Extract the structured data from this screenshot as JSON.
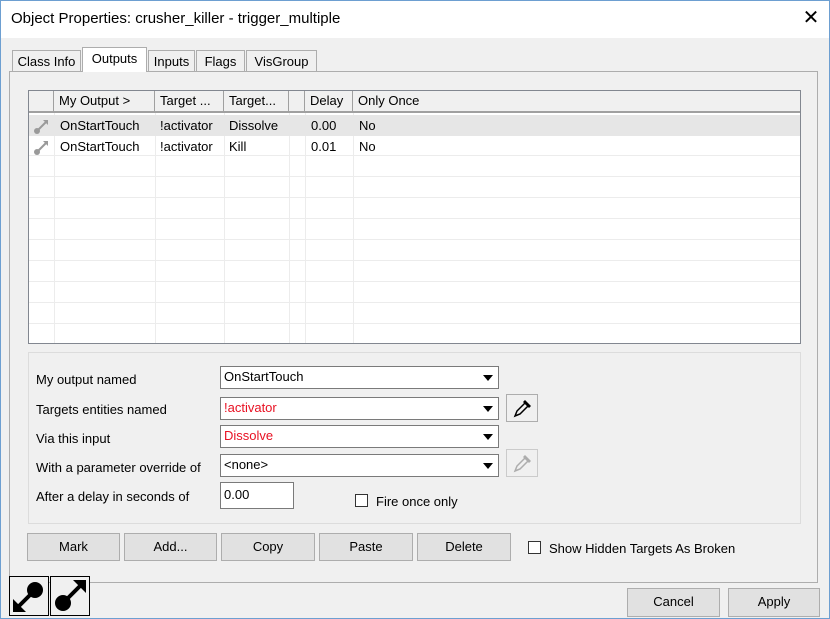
{
  "window": {
    "title": "Object Properties: crusher_killer - trigger_multiple",
    "close_glyph": "✕"
  },
  "tabs": [
    {
      "label": "Class Info",
      "selected": false
    },
    {
      "label": "Outputs",
      "selected": true
    },
    {
      "label": "Inputs",
      "selected": false
    },
    {
      "label": "Flags",
      "selected": false
    },
    {
      "label": "VisGroup",
      "selected": false
    }
  ],
  "outputs_table": {
    "columns": [
      "",
      "My Output  >",
      "Target ...",
      "Target...",
      "",
      "Delay",
      "Only Once"
    ],
    "rows": [
      {
        "icon": "output-connection-icon",
        "output": "OnStartTouch",
        "target": "!activator",
        "input": "Dissolve",
        "param": "",
        "delay": "0.00",
        "once": "No"
      },
      {
        "icon": "output-connection-icon",
        "output": "OnStartTouch",
        "target": "!activator",
        "input": "Kill",
        "param": "",
        "delay": "0.01",
        "once": "No"
      }
    ]
  },
  "editor": {
    "output_label": "My output named",
    "output_value": "OnStartTouch",
    "target_label": "Targets entities named",
    "target_value": "!activator",
    "input_label": "Via this input",
    "input_value": "Dissolve",
    "param_label": "With a parameter override of",
    "param_value": "<none>",
    "delay_label": "After a delay in seconds of",
    "delay_value": "0.00",
    "fire_once_label": "Fire once only",
    "fire_once_checked": false,
    "error_color": "#e81123"
  },
  "actions": {
    "mark": "Mark",
    "add": "Add...",
    "copy": "Copy",
    "paste": "Paste",
    "delete": "Delete",
    "show_hidden_label": "Show Hidden Targets As Broken",
    "show_hidden_checked": false
  },
  "bottom": {
    "cancel": "Cancel",
    "apply": "Apply",
    "left_icons": [
      "entity-inputs-icon",
      "entity-outputs-icon"
    ]
  }
}
